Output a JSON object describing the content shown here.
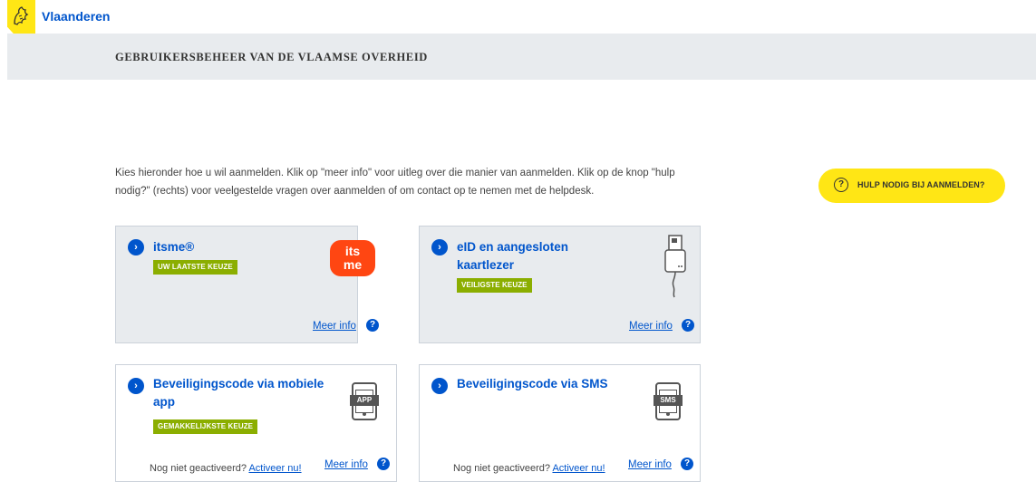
{
  "header": {
    "brand": "Vlaanderen",
    "title": "GEBRUIKERSBEHEER VAN DE VLAAMSE OVERHEID"
  },
  "intro": "Kies hieronder hoe u wil aanmelden. Klik op \"meer info\" voor uitleg over die manier van aanmelden. Klik op de knop \"hulp nodig?\" (rechts) voor veelgestelde vragen over aanmelden of om contact op te nemen met de helpdesk.",
  "help_button": {
    "label": "HULP NODIG BIJ AANMELDEN?"
  },
  "cards": {
    "itsme": {
      "title": "itsme®",
      "badge": "UW LAATSTE KEUZE",
      "meer": "Meer info",
      "logo_line1": "its",
      "logo_line2": "me"
    },
    "eid": {
      "title_line1": "eID en aangesloten",
      "title_line2": "kaartlezer",
      "badge": "VEILIGSTE KEUZE",
      "meer": "Meer info"
    },
    "app": {
      "title_line1": "Beveiligingscode via mobiele",
      "title_line2": "app",
      "badge": "GEMAKKELIJKSTE KEUZE",
      "note": "Nog niet geactiveerd?",
      "activate": "Activeer nu!",
      "meer": "Meer info",
      "icon_label": "APP"
    },
    "sms": {
      "title": "Beveiligingscode via SMS",
      "note": "Nog niet geactiveerd?",
      "activate": "Activeer nu!",
      "meer": "Meer info",
      "icon_label": "SMS"
    }
  },
  "colors": {
    "accent": "#0055cc",
    "yellow": "#ffe615",
    "badge_green": "#8bae00",
    "itsme_orange": "#ff4612",
    "panel_grey": "#e8ebee"
  }
}
